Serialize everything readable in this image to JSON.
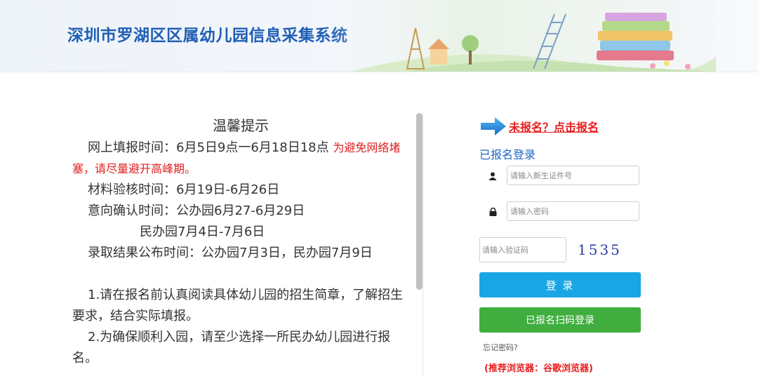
{
  "header": {
    "title": "深圳市罗湖区区属幼儿园信息采集系统"
  },
  "notice": {
    "title": "温馨提示",
    "fill_time": "网上填报时间：6月5日9点一6月18日18点",
    "fill_note": "为避免网络堵塞，请尽量避开高峰期。",
    "review_time": "材料验核时间：6月19日-6月26日",
    "confirm_time": "意向确认时间：公办园6月27-6月29日",
    "confirm_time_private": "民办园7月4日-7月6日",
    "result_time": "录取结果公布时间：公办园7月3日，民办园7月9日",
    "tip1": "1.请在报名前认真阅读具体幼儿园的招生简章，了解招生要求，结合实际填报。",
    "tip2": "2.为确保顺利入园，请至少选择一所民办幼儿园进行报名。"
  },
  "login": {
    "signup_link": "未报名？点击报名",
    "heading": "已报名登录",
    "id_placeholder": "请输入新生证件号",
    "password_placeholder": "请输入密码",
    "captcha_placeholder": "请输入验证码",
    "captcha_code": "1535",
    "login_button": "登 录",
    "qr_login_button": "已报名扫码登录",
    "forgot_password": "忘记密码?",
    "browser_note": "(推荐浏览器：谷歌浏览器)"
  },
  "colors": {
    "brand_blue": "#1f5fb5",
    "login_blue": "#1aa6e4",
    "qr_green": "#3fae3f",
    "alert_red": "#e81d1d"
  }
}
